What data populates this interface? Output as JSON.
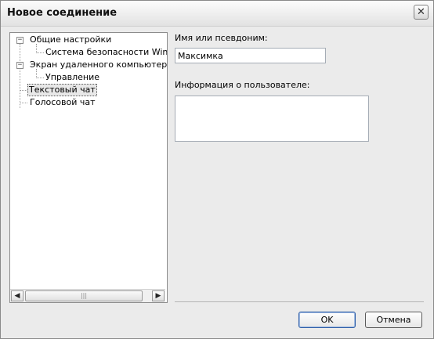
{
  "window": {
    "title": "Новое соединение",
    "close_symbol": "✕"
  },
  "tree": {
    "items": [
      {
        "label": "Общие настройки",
        "expander": "−"
      },
      {
        "label": "Система безопасности Windows"
      },
      {
        "label": "Экран удаленного компьютера",
        "expander": "−"
      },
      {
        "label": "Управление"
      },
      {
        "label": "Текстовый чат",
        "selected": true
      },
      {
        "label": "Голосовой чат"
      }
    ],
    "scroll_left": "◀",
    "scroll_right": "▶",
    "thumb_grip": "|||"
  },
  "form": {
    "nickname_label": "Имя или псевдоним:",
    "nickname_value": "Максимка",
    "userinfo_label": "Информация о пользователе:",
    "userinfo_value": ""
  },
  "buttons": {
    "ok": "OK",
    "cancel": "Отмена"
  }
}
